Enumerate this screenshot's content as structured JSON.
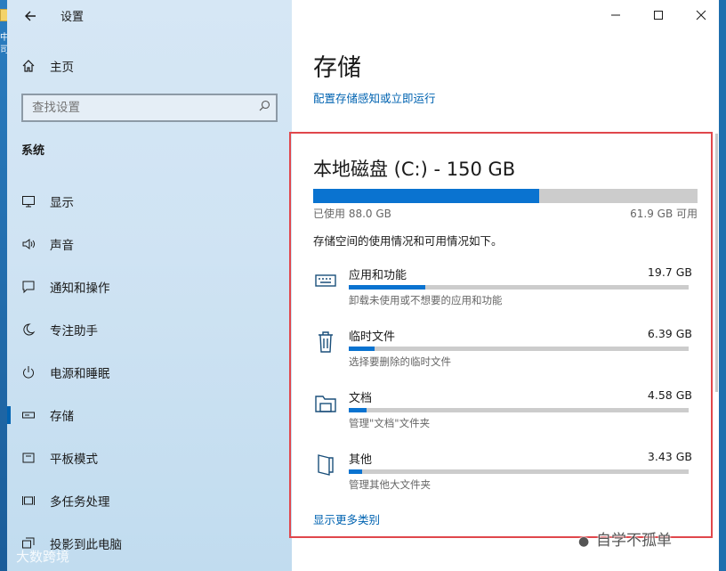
{
  "desktop": {
    "fragment_text": "中司"
  },
  "window": {
    "title": "设置"
  },
  "sidebar": {
    "home_label": "主页",
    "search_placeholder": "查找设置",
    "group_label": "系统",
    "items": [
      {
        "label": "显示",
        "icon": "monitor-icon"
      },
      {
        "label": "声音",
        "icon": "speaker-icon"
      },
      {
        "label": "通知和操作",
        "icon": "notification-icon"
      },
      {
        "label": "专注助手",
        "icon": "moon-icon"
      },
      {
        "label": "电源和睡眠",
        "icon": "power-icon"
      },
      {
        "label": "存储",
        "icon": "storage-icon",
        "active": true
      },
      {
        "label": "平板模式",
        "icon": "tablet-icon"
      },
      {
        "label": "多任务处理",
        "icon": "multitask-icon"
      },
      {
        "label": "投影到此电脑",
        "icon": "project-icon"
      }
    ]
  },
  "main": {
    "title": "存储",
    "config_link": "配置存储感知或立即运行",
    "disk": {
      "title": "本地磁盘 (C:) - 150 GB",
      "used_label": "已使用 88.0 GB",
      "free_label": "61.9 GB 可用",
      "used_fraction": 0.587
    },
    "description": "存储空间的使用情况和可用情况如下。",
    "categories": [
      {
        "name": "应用和功能",
        "size": "19.7 GB",
        "desc": "卸载未使用或不想要的应用和功能",
        "fraction": 0.225,
        "icon": "keyboard-icon"
      },
      {
        "name": "临时文件",
        "size": "6.39 GB",
        "desc": "选择要删除的临时文件",
        "fraction": 0.075,
        "icon": "trash-icon"
      },
      {
        "name": "文档",
        "size": "4.58 GB",
        "desc": "管理\"文档\"文件夹",
        "fraction": 0.053,
        "icon": "folder-icon"
      },
      {
        "name": "其他",
        "size": "3.43 GB",
        "desc": "管理其他大文件夹",
        "fraction": 0.04,
        "icon": "other-folder-icon"
      }
    ],
    "more_link": "显示更多类别"
  },
  "watermarks": {
    "left": "大数跨境",
    "right": "自学不孤单"
  },
  "colors": {
    "accent": "#0063b1",
    "bar_fill": "#0a73d0",
    "bar_bg": "#cccccc",
    "highlight": "#e0474c"
  }
}
